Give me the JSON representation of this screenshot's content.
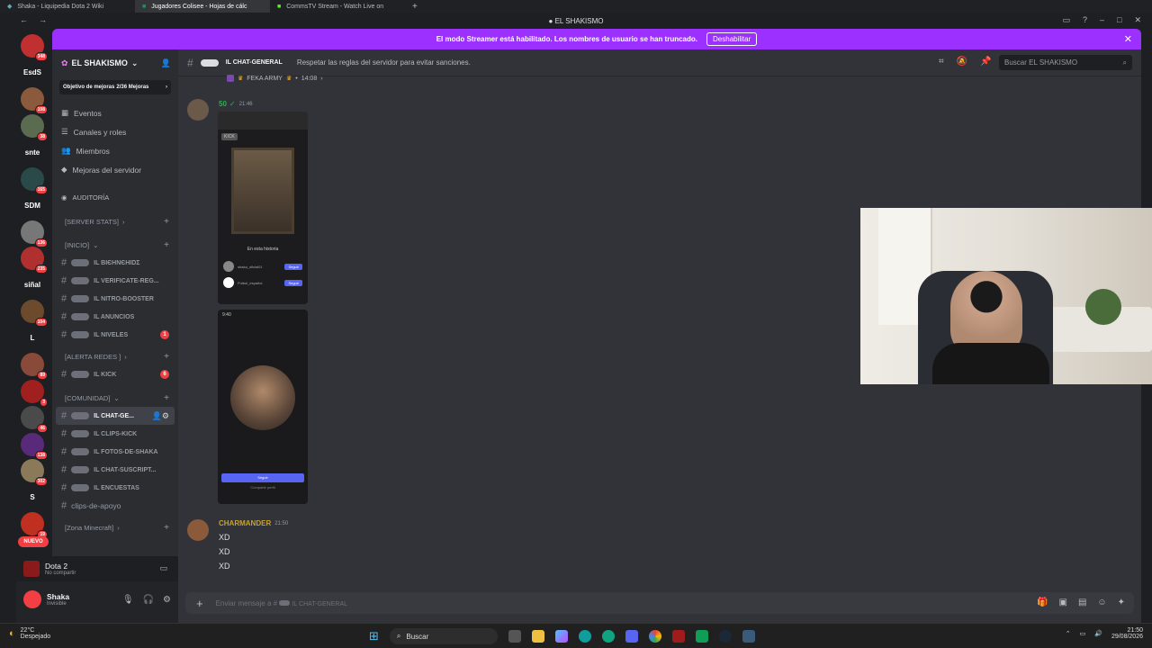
{
  "browser": {
    "tabs": [
      {
        "label": "Shaka - Liquipedia Dota 2 Wiki",
        "active": false
      },
      {
        "label": "Jugadores Colisee - Hojas de cálc",
        "active": true
      },
      {
        "label": "CommsTV Stream - Watch Live on",
        "active": false
      }
    ]
  },
  "window": {
    "title": "EL SHAKISMO"
  },
  "streamer_banner": {
    "text": "El modo Streamer está habilitado. Los nombres de usuario se han truncado.",
    "button": "Deshabilitar"
  },
  "guilds": [
    {
      "label": "",
      "color": "#c03030",
      "badge": "348"
    },
    {
      "label": "EsdS",
      "color": "#1e1f22",
      "badge": ""
    },
    {
      "label": "",
      "color": "#8b5a3c",
      "badge": "108"
    },
    {
      "label": "",
      "color": "#5a6b50",
      "badge": "38"
    },
    {
      "label": "snte",
      "color": "#1e1f22",
      "badge": ""
    },
    {
      "label": "",
      "color": "#2a4a4a",
      "badge": "165"
    },
    {
      "label": "SDM",
      "color": "#1e1f22",
      "badge": ""
    },
    {
      "label": "",
      "color": "#777777",
      "badge": "136"
    },
    {
      "label": "",
      "color": "#b03030",
      "badge": "235"
    },
    {
      "label": "siñal",
      "color": "#1e1f22",
      "badge": ""
    },
    {
      "label": "",
      "color": "#6b4b2b",
      "badge": "104"
    },
    {
      "label": "L",
      "color": "#1e1f22",
      "badge": ""
    },
    {
      "label": "",
      "color": "#8a4a3a",
      "badge": "89"
    },
    {
      "label": "",
      "color": "#a02020",
      "badge": "3"
    },
    {
      "label": "",
      "color": "#4a4a4a",
      "badge": "46"
    },
    {
      "label": "",
      "color": "#5a2a7a",
      "badge": "138"
    },
    {
      "label": "",
      "color": "#8a7a5a",
      "badge": "302"
    },
    {
      "label": "S",
      "color": "#1e1f22",
      "badge": ""
    },
    {
      "label": "",
      "color": "#c03020",
      "badge": "19"
    }
  ],
  "guild_new_label": "NUEVO",
  "server": {
    "name": "EL SHAKISMO",
    "boost_goal": "Objetivo de mejoras",
    "boost_count": "2/36 Mejoras",
    "menu": [
      "Eventos",
      "Canales y roles",
      "Miembros",
      "Mejoras del servidor"
    ],
    "audit": "Auditoría",
    "categories": {
      "stats": "[SERVER STATS]",
      "inicio": "[INICIO]",
      "alerta": "[ALERTA REDES ]",
      "comunidad": "[COMUNIDAD]",
      "minecraft": "[Zona Minecraft]"
    },
    "inicio_channels": [
      {
        "name": "ıl вιєηνєηιdσ",
        "badge": ""
      },
      {
        "name": "ıl verificate-reg...",
        "badge": ""
      },
      {
        "name": "ıl nitro-booster",
        "badge": ""
      },
      {
        "name": "ıl anuncios",
        "badge": ""
      },
      {
        "name": "ıl niveles",
        "badge": "1"
      }
    ],
    "alerta_channels": [
      {
        "name": "ıl kick",
        "badge": "6"
      }
    ],
    "comunidad_channels": [
      {
        "name": "ıl chat-ge...",
        "active": true
      },
      {
        "name": "ıl clips-kick",
        "active": false
      },
      {
        "name": "ıl fotos-de-shaka",
        "active": false
      },
      {
        "name": "ıl chat-suscript...",
        "active": false
      },
      {
        "name": "ıl encuestas",
        "active": false
      },
      {
        "name": "clips-de-apoyo",
        "active": false
      }
    ]
  },
  "activity": {
    "game": "Dota 2",
    "status": "No compartir"
  },
  "user": {
    "name": "Shaka",
    "status": "Invisible"
  },
  "chat": {
    "channel": "ıl chat-general",
    "topic": "Respetar las reglas del servidor para evitar sanciones.",
    "search_placeholder": "Buscar EL SHAKISMO",
    "reply_ref": "FEKA ARMY",
    "reply_time": "14:08",
    "msg1_author": "50",
    "msg1_time": "21:46",
    "phone1": {
      "story": "En esta historia",
      "user1": "shaka_oficial01",
      "user2": "Fútbol_español",
      "follow": "Seguir",
      "brand": "KICK"
    },
    "phone2": {
      "time": "9:40",
      "button": "Seguir",
      "sub": "Compartir perfil"
    },
    "msg2_author": "CHARMANDER",
    "msg2_time": "21:50",
    "msg2_lines": [
      "XD",
      "XD",
      "XD"
    ],
    "composer_placeholder": "Enviar mensaje a #",
    "composer_channel": "ıl chat-general"
  },
  "taskbar": {
    "weather_temp": "22°C",
    "weather_desc": "Despejado",
    "search_label": "Buscar",
    "time": "21:50",
    "date": "29/08/2026"
  }
}
